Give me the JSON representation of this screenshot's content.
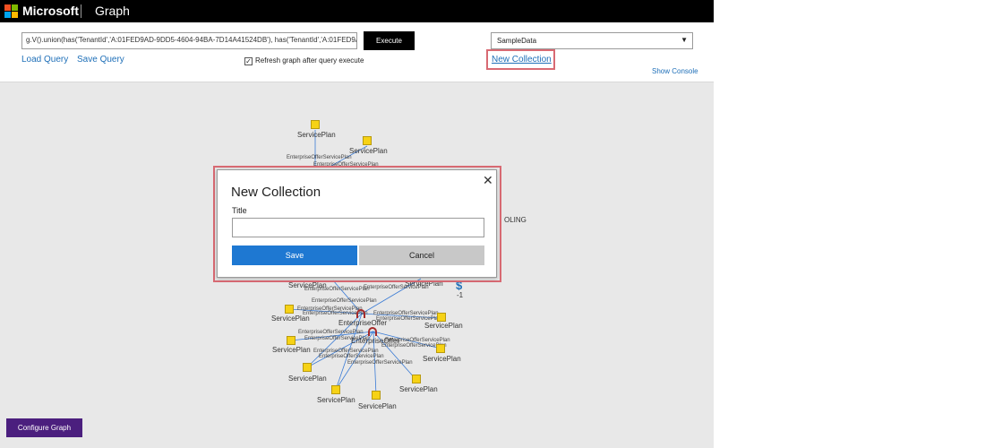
{
  "header": {
    "brand": "Microsoft",
    "app_title": "Graph"
  },
  "toolbar": {
    "query_value": "g.V().union(has('TenantId','A:01FED9AD-9DD5-4604-94BA-7D14A41524DB'), has('TenantId','A:01FED9AD-9DD5-46",
    "execute_label": "Execute",
    "load_query_label": "Load Query",
    "save_query_label": "Save Query",
    "refresh_label": "Refresh graph after query execute",
    "refresh_checked": true,
    "collection_selected": "SampleData",
    "new_collection_label": "New Collection",
    "show_console_label": "Show Console"
  },
  "graph": {
    "node_label": "ServicePlan",
    "edge_label": "EnterpriseOfferServicePlan",
    "offer_label": "EnterpriseOffer",
    "partial_label": "OLING",
    "dollar_label": "$",
    "dollar_value": "-1"
  },
  "modal": {
    "title": "New Collection",
    "close_symbol": "✕",
    "title_field_label": "Title",
    "title_field_value": "",
    "save_label": "Save",
    "cancel_label": "Cancel"
  },
  "footer": {
    "configure_label": "Configure Graph"
  },
  "colors": {
    "accent_blue": "#1e78d2",
    "link_blue": "#1e6fb8",
    "highlight_red": "#d86a73",
    "node_yellow": "#f6d216",
    "configure_purple": "#4b1f7e"
  }
}
